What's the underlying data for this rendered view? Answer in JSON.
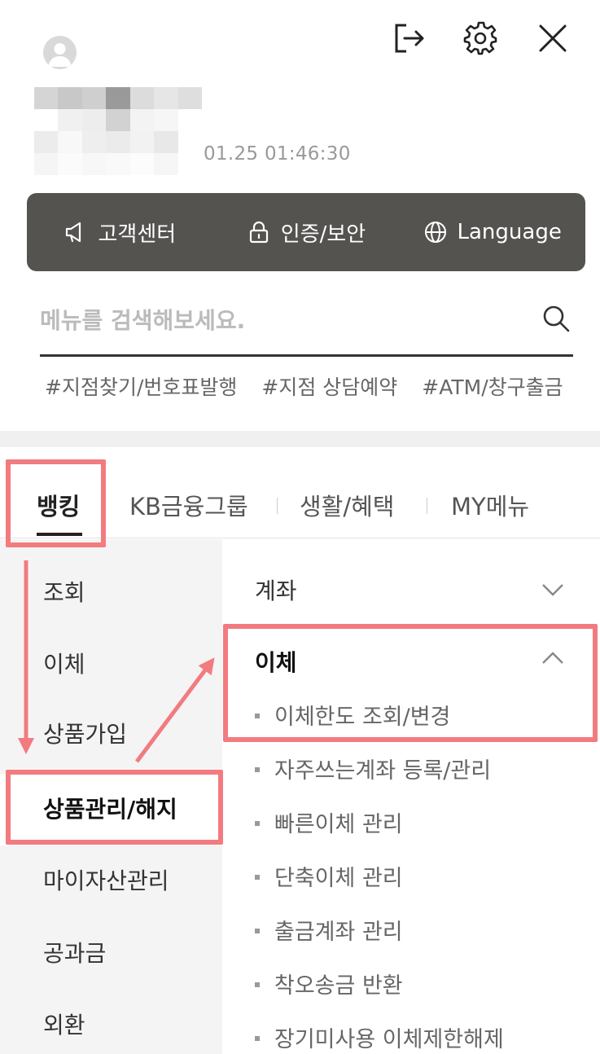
{
  "header": {
    "login_time": "01.25 01:46:30",
    "icons": {
      "logout": "logout-icon",
      "settings": "gear-icon",
      "close": "close-icon",
      "avatar": "user-icon"
    }
  },
  "quick_menu": {
    "items": [
      {
        "label": "고객센터",
        "icon": "megaphone-icon"
      },
      {
        "label": "인증/보안",
        "icon": "lock-icon"
      },
      {
        "label": "Language",
        "icon": "globe-icon"
      }
    ]
  },
  "search": {
    "placeholder": "메뉴를 검색해보세요.",
    "value": "",
    "icon": "search-icon"
  },
  "tags": [
    "#지점찾기/번호표발행",
    "#지점 상담예약",
    "#ATM/창구출금"
  ],
  "tabs": [
    {
      "label": "뱅킹",
      "active": true
    },
    {
      "label": "KB금융그룹",
      "active": false
    },
    {
      "label": "생활/혜택",
      "active": false
    },
    {
      "label": "MY메뉴",
      "active": false
    }
  ],
  "left_nav": {
    "items": [
      {
        "label": "조회"
      },
      {
        "label": "이체"
      },
      {
        "label": "상품가입"
      },
      {
        "label": "상품관리/해지",
        "active": true
      },
      {
        "label": "마이자산관리"
      },
      {
        "label": "공과금"
      },
      {
        "label": "외환"
      }
    ]
  },
  "content": {
    "sections": [
      {
        "title": "계좌",
        "expanded": false
      },
      {
        "title": "이체",
        "expanded": true
      }
    ],
    "sub_items": [
      "이체한도 조회/변경",
      "자주쓰는계좌 등록/관리",
      "빠른이체 관리",
      "단축이체 관리",
      "출금계좌 관리",
      "착오송금 반환",
      "장기미사용 이체제한해제"
    ]
  },
  "colors": {
    "quick_bar_bg": "#545350",
    "highlight": "#f27b80",
    "leftnav_bg": "#f4f4f4"
  }
}
